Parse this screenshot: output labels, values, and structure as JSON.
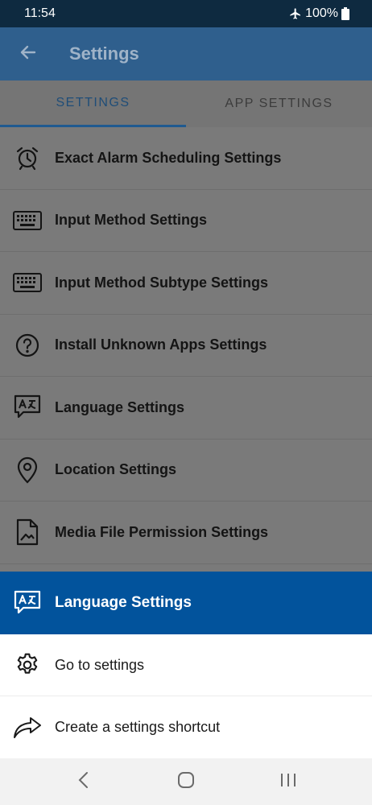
{
  "status_bar": {
    "time": "11:54",
    "battery": "100%",
    "icons": [
      "airplane-icon",
      "battery-icon"
    ]
  },
  "app_bar": {
    "title": "Settings",
    "back_icon": "arrow-left-icon"
  },
  "tabs": [
    {
      "label": "SETTINGS",
      "active": true
    },
    {
      "label": "APP SETTINGS",
      "active": false
    }
  ],
  "list": {
    "items": [
      {
        "label": "Exact Alarm Scheduling Settings",
        "icon": "alarm-clock-icon"
      },
      {
        "label": "Input Method Settings",
        "icon": "keyboard-icon"
      },
      {
        "label": "Input Method Subtype Settings",
        "icon": "keyboard-icon"
      },
      {
        "label": "Install Unknown Apps Settings",
        "icon": "question-circle-icon"
      },
      {
        "label": "Language Settings",
        "icon": "translate-icon"
      },
      {
        "label": "Location Settings",
        "icon": "location-pin-icon"
      },
      {
        "label": "Media File Permission Settings",
        "icon": "image-file-icon"
      }
    ]
  },
  "sheet": {
    "title": "Language Settings",
    "title_icon": "translate-icon",
    "actions": [
      {
        "label": "Go to settings",
        "icon": "gear-icon"
      },
      {
        "label": "Create a settings shortcut",
        "icon": "share-arrow-icon"
      }
    ]
  },
  "nav_bar": {
    "icons": [
      "back-chevron-icon",
      "home-icon",
      "recents-icon"
    ]
  },
  "colors": {
    "accent": "#02539c",
    "app_bar": "#2f5f8d",
    "status_bar": "#0e2a40"
  }
}
